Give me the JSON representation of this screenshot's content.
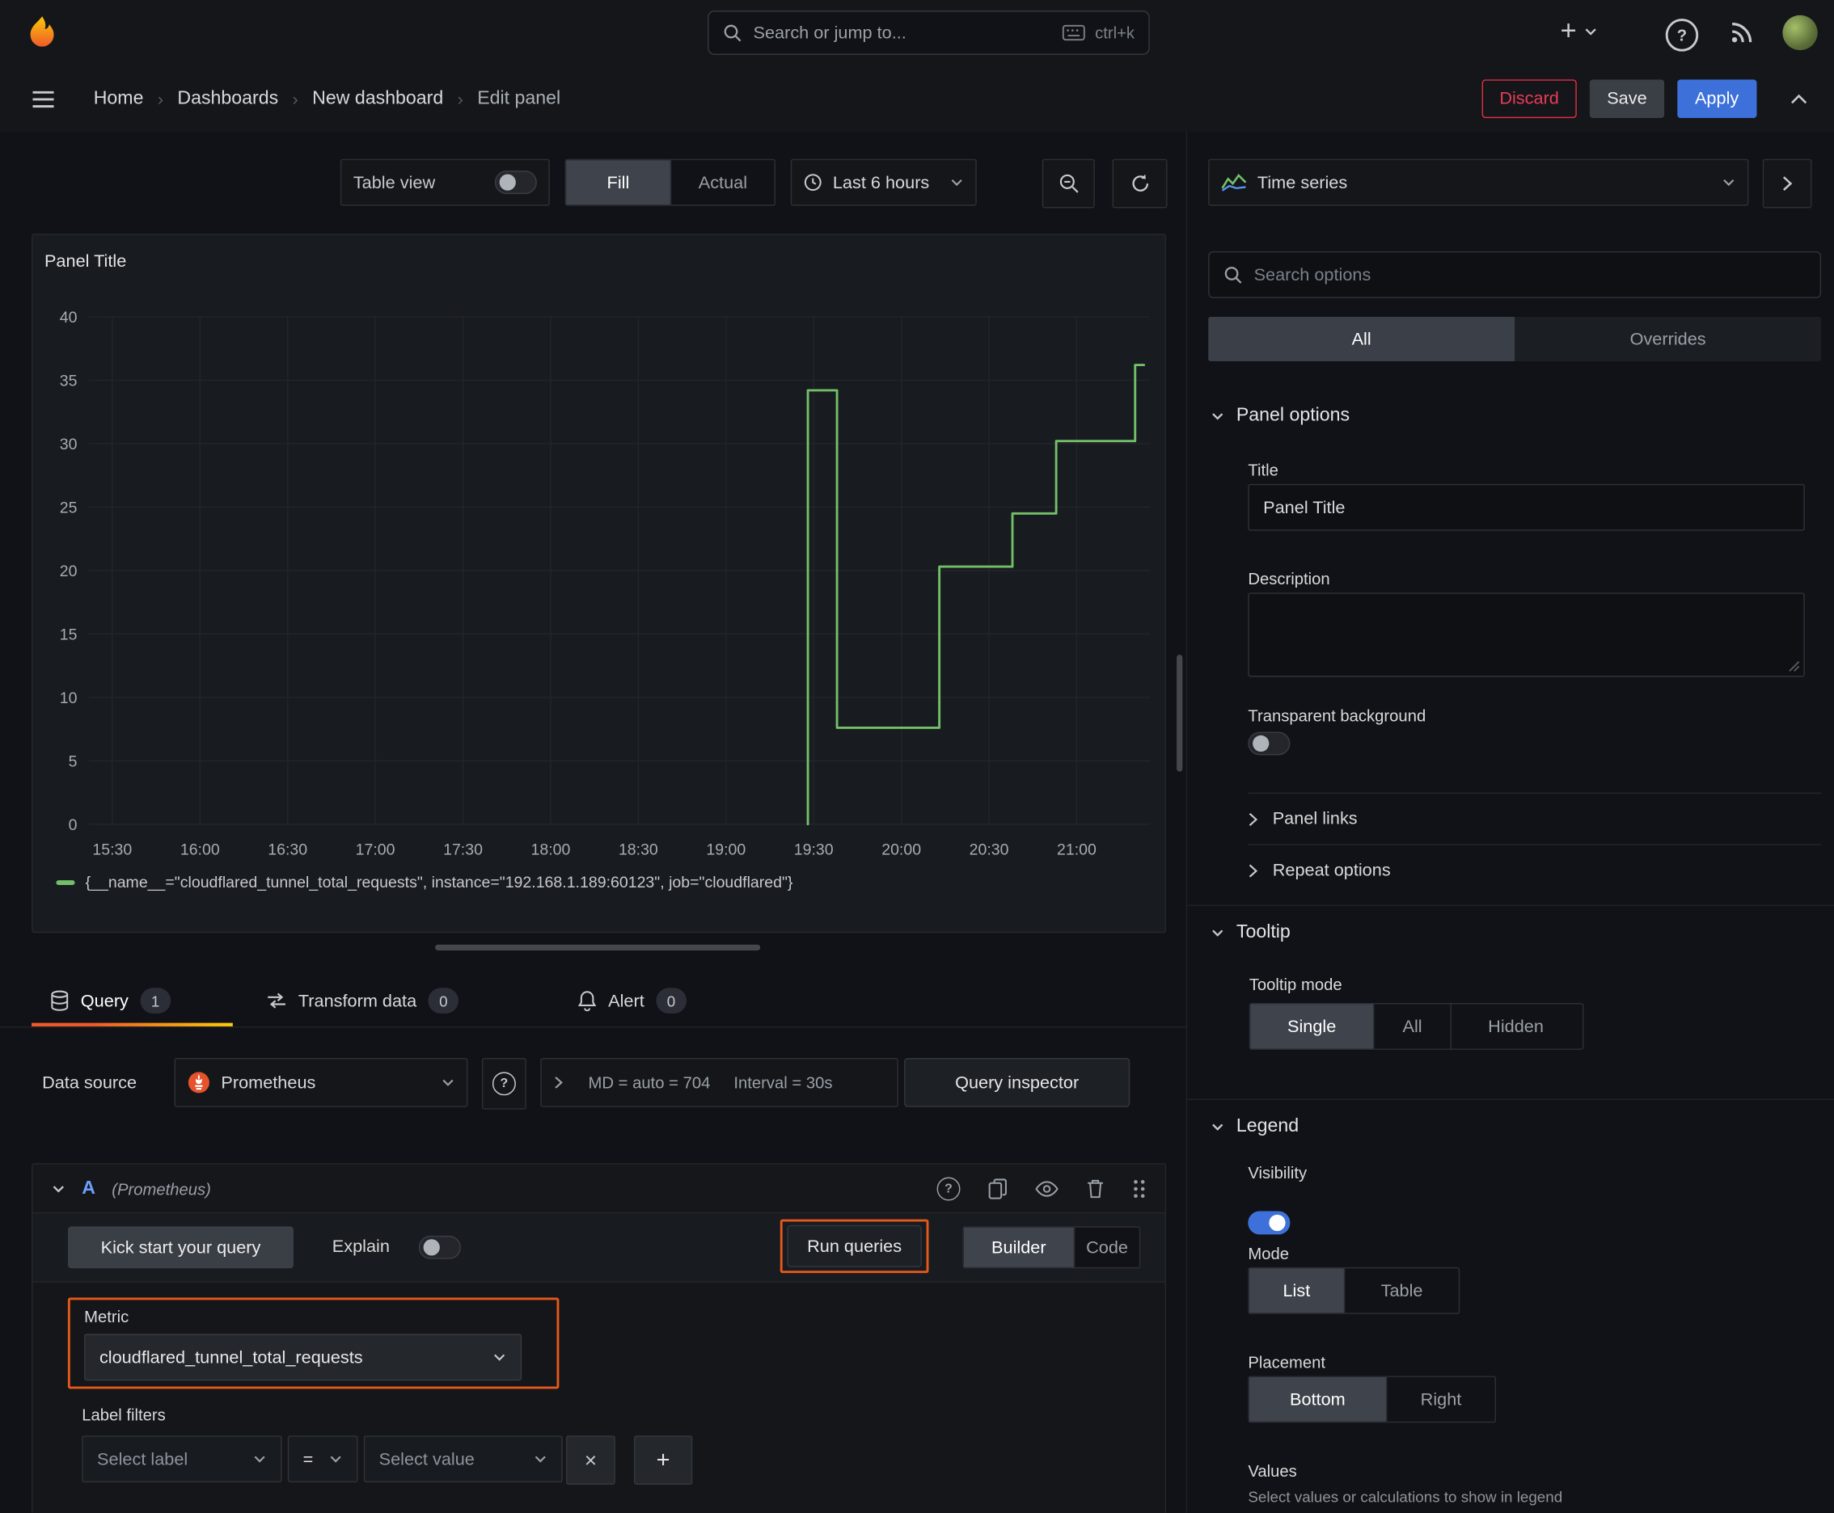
{
  "topnav": {
    "search_placeholder": "Search or jump to...",
    "shortcut": "ctrl+k"
  },
  "breadcrumb": {
    "items": [
      "Home",
      "Dashboards",
      "New dashboard",
      "Edit panel"
    ],
    "discard": "Discard",
    "save": "Save",
    "apply": "Apply"
  },
  "toolbar": {
    "table_view": "Table view",
    "fill": "Fill",
    "actual": "Actual",
    "time_range": "Last 6 hours"
  },
  "panel": {
    "title": "Panel Title"
  },
  "chart_data": {
    "type": "line",
    "title": "Panel Title",
    "x_unit": "minutes since 15:30",
    "xlim": [
      -8,
      355
    ],
    "ylim": [
      0,
      40
    ],
    "y_ticks": [
      0,
      5,
      10,
      15,
      20,
      25,
      30,
      35,
      40
    ],
    "x_ticks": [
      {
        "t": 0,
        "label": "15:30"
      },
      {
        "t": 30,
        "label": "16:00"
      },
      {
        "t": 60,
        "label": "16:30"
      },
      {
        "t": 90,
        "label": "17:00"
      },
      {
        "t": 120,
        "label": "17:30"
      },
      {
        "t": 150,
        "label": "18:00"
      },
      {
        "t": 180,
        "label": "18:30"
      },
      {
        "t": 210,
        "label": "19:00"
      },
      {
        "t": 240,
        "label": "19:30"
      },
      {
        "t": 270,
        "label": "20:00"
      },
      {
        "t": 300,
        "label": "20:30"
      },
      {
        "t": 330,
        "label": "21:00"
      }
    ],
    "grid": true,
    "legend_position": "bottom",
    "series": [
      {
        "name": "{__name__=\"cloudflared_tunnel_total_requests\", instance=\"192.168.1.189:60123\", job=\"cloudflared\"}",
        "color": "#73bf69",
        "step": true,
        "points": [
          [
            238,
            0
          ],
          [
            238,
            34.2
          ],
          [
            248,
            34.2
          ],
          [
            248,
            7.6
          ],
          [
            283,
            7.6
          ],
          [
            283,
            20.3
          ],
          [
            308,
            20.3
          ],
          [
            308,
            24.5
          ],
          [
            323,
            24.5
          ],
          [
            323,
            30.2
          ],
          [
            350,
            30.2
          ],
          [
            350,
            36.2
          ],
          [
            353,
            36.2
          ]
        ]
      }
    ]
  },
  "tabs": {
    "query": "Query",
    "query_count": "1",
    "transform": "Transform data",
    "transform_count": "0",
    "alert": "Alert",
    "alert_count": "0"
  },
  "query": {
    "datasource_label": "Data source",
    "datasource": "Prometheus",
    "stat_md": "MD = auto = 704",
    "stat_interval": "Interval = 30s",
    "inspector": "Query inspector",
    "ref_id": "A",
    "ref_ds": "(Prometheus)",
    "kickstart": "Kick start your query",
    "explain": "Explain",
    "run": "Run queries",
    "builder": "Builder",
    "code": "Code",
    "metric_label": "Metric",
    "metric_value": "cloudflared_tunnel_total_requests",
    "label_filters": "Label filters",
    "select_label": "Select label",
    "operator": "=",
    "select_value": "Select value"
  },
  "sidebar": {
    "viz": "Time series",
    "search_placeholder": "Search options",
    "tab_all": "All",
    "tab_overrides": "Overrides",
    "panel_options": {
      "title": "Panel options",
      "title_label": "Title",
      "title_value": "Panel Title",
      "description_label": "Description",
      "transparent": "Transparent background",
      "links": "Panel links",
      "repeat": "Repeat options"
    },
    "tooltip": {
      "title": "Tooltip",
      "mode_label": "Tooltip mode",
      "single": "Single",
      "all": "All",
      "hidden": "Hidden"
    },
    "legend": {
      "title": "Legend",
      "visibility": "Visibility",
      "mode_label": "Mode",
      "list": "List",
      "table": "Table",
      "placement_label": "Placement",
      "bottom": "Bottom",
      "right": "Right",
      "values_label": "Values",
      "values_desc": "Select values or calculations to show in legend"
    }
  },
  "colors": {
    "accent_blue": "#3d71d9",
    "highlight_orange": "#e5591c",
    "series_green": "#73bf69",
    "danger_red": "#e02f44",
    "tab_underline": "#f05a28"
  }
}
